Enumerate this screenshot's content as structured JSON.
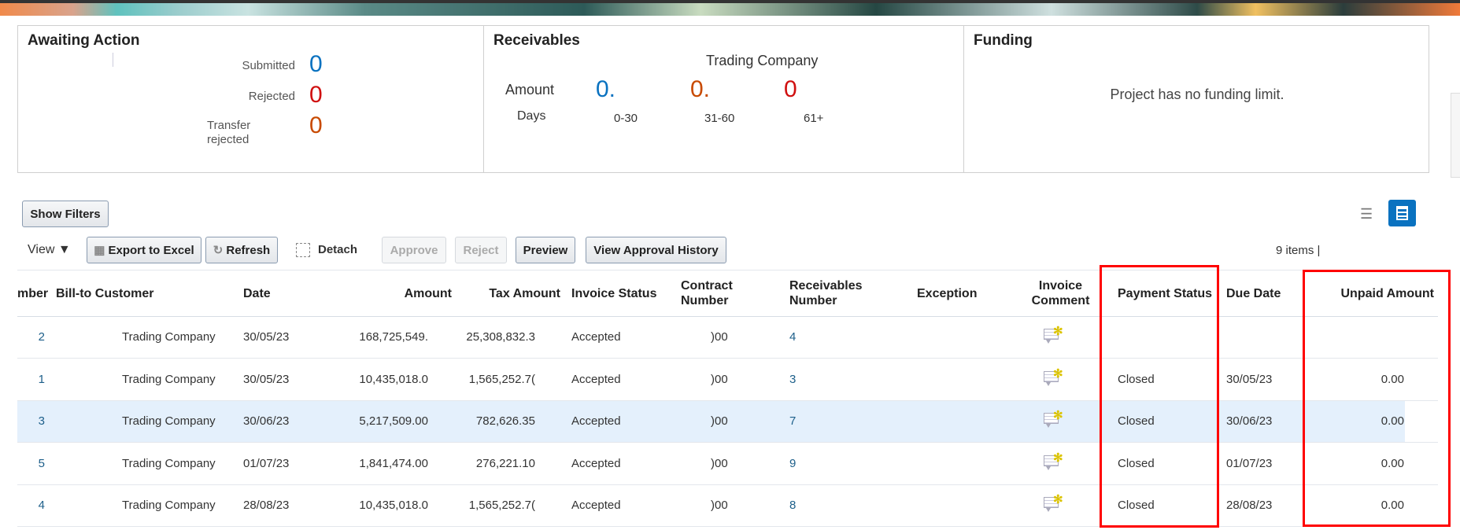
{
  "awaiting": {
    "title": "Awaiting Action",
    "submitted_label": "Submitted",
    "submitted": "0",
    "rejected_label": "Rejected",
    "rejected": "0",
    "transfer_label_1": "Transfer",
    "transfer_label_2": "rejected",
    "transfer": "0"
  },
  "receivables": {
    "title": "Receivables",
    "customer": "Trading Company",
    "amount_label": "Amount",
    "days_label": "Days",
    "buckets": [
      {
        "value": "0.",
        "days": "0-30"
      },
      {
        "value": "0.",
        "days": "31-60"
      },
      {
        "value": "0",
        "days": "61+"
      }
    ]
  },
  "funding": {
    "title": "Funding",
    "message": "Project has no funding limit."
  },
  "toolbar": {
    "show_filters": "Show Filters",
    "view": "View",
    "export": "Export to Excel",
    "refresh": "Refresh",
    "detach": "Detach",
    "approve": "Approve",
    "reject": "Reject",
    "preview": "Preview",
    "history": "View Approval History",
    "items": "9 items |"
  },
  "colors": {
    "accent": "#0a72c0",
    "highlight": "#e4f0fc",
    "annotation": "#ff0000"
  },
  "table": {
    "headers": {
      "number": "mber",
      "customer": "Bill-to Customer",
      "date": "Date",
      "amount": "Amount",
      "tax": "Tax Amount",
      "status": "Invoice Status",
      "contract_1": "Contract",
      "contract_2": "Number",
      "recv_1": "Receivables",
      "recv_2": "Number",
      "exception": "Exception",
      "comment_1": "Invoice",
      "comment_2": "Comment",
      "payment": "Payment Status",
      "due": "Due Date",
      "unpaid": "Unpaid Amount"
    },
    "rows": [
      {
        "number": "2",
        "customer": "Trading Company",
        "date": "30/05/23",
        "amount": "168,725,549.",
        "tax": "25,308,832.3",
        "status": "Accepted",
        "contract": ")00",
        "recv": "4",
        "payment": "",
        "due": "",
        "unpaid": ""
      },
      {
        "number": "1",
        "customer": "Trading Company",
        "date": "30/05/23",
        "amount": "10,435,018.0",
        "tax": "1,565,252.7(",
        "status": "Accepted",
        "contract": ")00",
        "recv": "3",
        "payment": "Closed",
        "due": "30/05/23",
        "unpaid": "0.00"
      },
      {
        "number": "3",
        "customer": "Trading Company",
        "date": "30/06/23",
        "amount": "5,217,509.00",
        "tax": "782,626.35",
        "status": "Accepted",
        "contract": ")00",
        "recv": "7",
        "payment": "Closed",
        "due": "30/06/23",
        "unpaid": "0.00",
        "selected": true
      },
      {
        "number": "5",
        "customer": "Trading Company",
        "date": "01/07/23",
        "amount": "1,841,474.00",
        "tax": "276,221.10",
        "status": "Accepted",
        "contract": ")00",
        "recv": "9",
        "payment": "Closed",
        "due": "01/07/23",
        "unpaid": "0.00"
      },
      {
        "number": "4",
        "customer": "Trading Company",
        "date": "28/08/23",
        "amount": "10,435,018.0",
        "tax": "1,565,252.7(",
        "status": "Accepted",
        "contract": ")00",
        "recv": "8",
        "payment": "Closed",
        "due": "28/08/23",
        "unpaid": "0.00"
      }
    ]
  }
}
